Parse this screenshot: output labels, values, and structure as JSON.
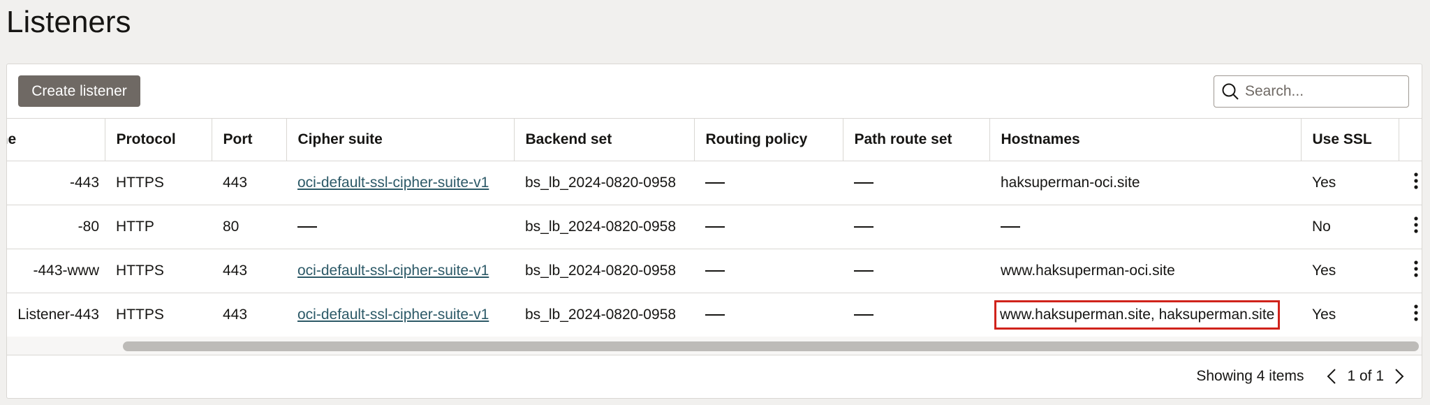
{
  "page": {
    "title": "Listeners"
  },
  "toolbar": {
    "create_label": "Create listener",
    "search_placeholder": "Search..."
  },
  "table": {
    "columns": [
      "Name",
      "Protocol",
      "Port",
      "Cipher suite",
      "Backend set",
      "Routing policy",
      "Path route set",
      "Hostnames",
      "Use SSL"
    ],
    "rows": [
      {
        "name": "-443",
        "protocol": "HTTPS",
        "port": "443",
        "cipher": "oci-default-ssl-cipher-suite-v1",
        "backend": "bs_lb_2024-0820-0958",
        "routing": "",
        "path": "",
        "hostnames": "haksuperman-oci.site",
        "ssl": "Yes"
      },
      {
        "name": "-80",
        "protocol": "HTTP",
        "port": "80",
        "cipher": "",
        "backend": "bs_lb_2024-0820-0958",
        "routing": "",
        "path": "",
        "hostnames": "",
        "ssl": "No"
      },
      {
        "name": "-443-www",
        "protocol": "HTTPS",
        "port": "443",
        "cipher": "oci-default-ssl-cipher-suite-v1",
        "backend": "bs_lb_2024-0820-0958",
        "routing": "",
        "path": "",
        "hostnames": "www.haksuperman-oci.site",
        "ssl": "Yes"
      },
      {
        "name": "Listener-443",
        "protocol": "HTTPS",
        "port": "443",
        "cipher": "oci-default-ssl-cipher-suite-v1",
        "backend": "bs_lb_2024-0820-0958",
        "routing": "",
        "path": "",
        "hostnames": "www.haksuperman.site, haksuperman.site",
        "ssl": "Yes"
      }
    ]
  },
  "footer": {
    "showing": "Showing 4 items",
    "page": "1 of 1"
  },
  "colors": {
    "highlight": "#d0231b",
    "link": "#2c5967",
    "button": "#6f6964"
  },
  "icons": {
    "search": "search-icon",
    "prev": "chevron-left-icon",
    "next": "chevron-right-icon",
    "actions": "kebab-menu-icon"
  }
}
